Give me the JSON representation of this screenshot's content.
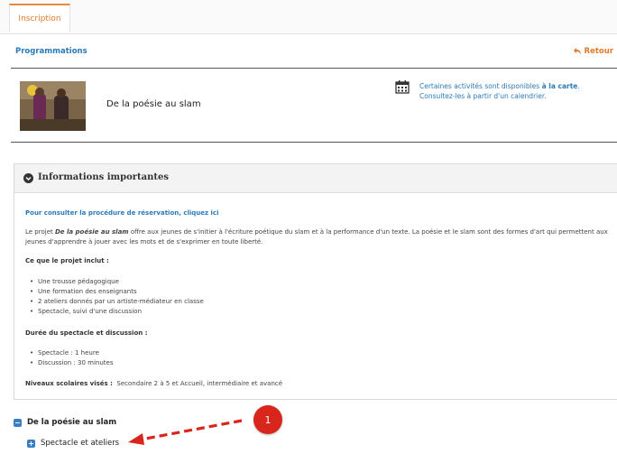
{
  "tabs": [
    {
      "label": "Inscription",
      "active": true
    }
  ],
  "header": {
    "title": "Programmations",
    "back_label": "Retour"
  },
  "program": {
    "name": "De la poésie au slam",
    "calendar_text_1": "Certaines activités sont disponibles ",
    "calendar_text_bold": "à la carte",
    "calendar_text_2": "Consultez-les à partir d'un calendrier."
  },
  "info_panel": {
    "title": "Informations importantes",
    "reservation_link": "Pour consulter la procédure de réservation, cliquez ici",
    "intro_prefix": "Le projet ",
    "intro_bold": "De la poésie au slam",
    "intro_rest": " offre aux jeunes de s'initier à l'écriture poétique du slam et à la performance d'un texte. La poésie et le slam sont des formes d'art qui permettent aux jeunes d'apprendre à jouer avec les mots et de s'exprimer en toute liberté.",
    "includes_heading": "Ce que le projet inclut :",
    "includes": [
      "Une trousse pédagogique",
      "Une formation des enseignants",
      "2 ateliers donnés par un artiste-médiateur en classe",
      "Spectacle, suivi d'une discussion"
    ],
    "duration_heading": "Durée du spectacle et discussion :",
    "durations": [
      "Spectacle : 1 heure",
      "Discussion : 30 minutes"
    ],
    "levels_label": "Niveaux scolaires visés :",
    "levels_value": "Secondaire 2 à 5 et Accueil, intermédiaire et avancé"
  },
  "tree": {
    "parent_label": "De la poésie au slam",
    "parent_icon": "minus-square-icon",
    "child_label": "Spectacle et ateliers",
    "child_icon": "plus-square-icon"
  },
  "annotation": {
    "badge": "1",
    "color": "#d9261c"
  }
}
